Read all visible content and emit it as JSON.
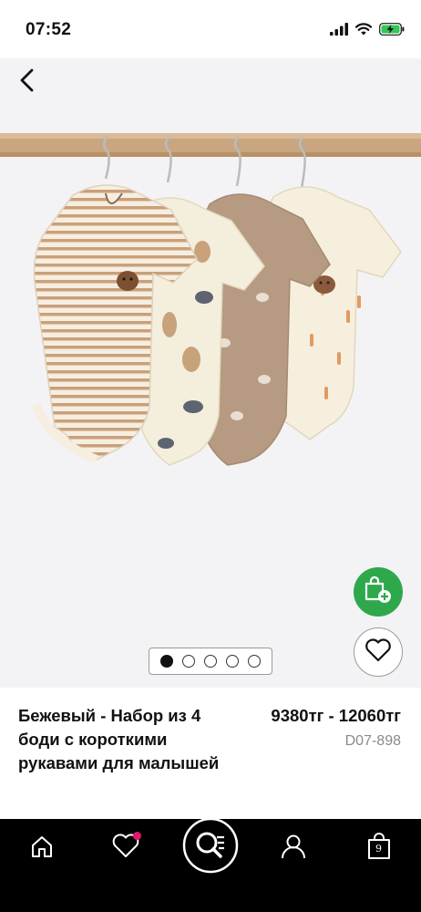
{
  "status_bar": {
    "time": "07:52",
    "icons": [
      "signal-icon",
      "wifi-icon",
      "battery-charging-icon"
    ]
  },
  "gallery": {
    "back_icon": "chevron-left-icon",
    "image_alt": "Набор из 4 боди с короткими рукавами",
    "pager": {
      "total": 5,
      "active_index": 0
    },
    "add_to_bag_icon": "shopping-bag-plus-icon",
    "wishlist_icon": "heart-icon"
  },
  "product": {
    "title": "Бежевый - Набор из 4 боди с короткими рукавами для малышей",
    "price": "9380тг - 12060тг",
    "code": "D07-898"
  },
  "nav": {
    "items": [
      "home-icon",
      "wishlist-icon",
      "search-icon",
      "account-icon",
      "bag-icon"
    ],
    "bag_count": "9",
    "wishlist_has_badge": true
  },
  "colors": {
    "accent_green": "#2ea84b",
    "badge_pink": "#e0196b",
    "nav_background": "#000000"
  }
}
